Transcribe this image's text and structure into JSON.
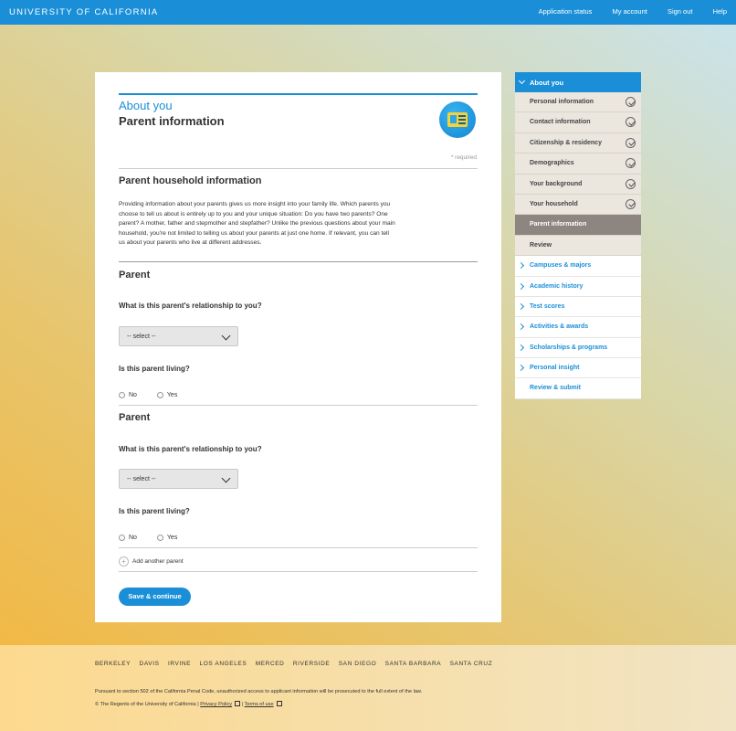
{
  "header": {
    "brand": "UNIVERSITY OF CALIFORNIA",
    "nav": [
      "Application status",
      "My account",
      "Sign out",
      "Help"
    ]
  },
  "page": {
    "section": "About you",
    "title": "Parent information",
    "required_note": "* required",
    "household_heading": "Parent household information",
    "intro": "Providing information about your parents gives us more insight into your family life. Which parents you choose to tell us about is entirely up to you and your unique situation: Do you have two parents? One parent? A mother, father and stepmother and stepfather? Unlike the previous questions about your main household, you're not limited to telling us about your parents at just one home. If relevant, you can tell us about your parents who live at different addresses.",
    "parents": [
      {
        "heading": "Parent",
        "relationship_question": "What is this parent's relationship to you?",
        "relationship_value": "-- select --",
        "living_question": "Is this parent living?",
        "options": [
          "No",
          "Yes"
        ]
      },
      {
        "heading": "Parent",
        "relationship_question": "What is this parent's relationship to you?",
        "relationship_value": "-- select --",
        "living_question": "Is this parent living?",
        "options": [
          "No",
          "Yes"
        ]
      }
    ],
    "add_parent": "Add another parent",
    "save_button": "Save & continue"
  },
  "sidebar": {
    "head": "About you",
    "subitems": [
      {
        "label": "Personal information",
        "complete": true
      },
      {
        "label": "Contact information",
        "complete": true
      },
      {
        "label": "Citizenship & residency",
        "complete": true
      },
      {
        "label": "Demographics",
        "complete": true
      },
      {
        "label": "Your background",
        "complete": true
      },
      {
        "label": "Your household",
        "complete": true
      },
      {
        "label": "Parent information",
        "complete": false,
        "active": true
      },
      {
        "label": "Review",
        "complete": false
      }
    ],
    "items": [
      "Campuses & majors",
      "Academic history",
      "Test scores",
      "Activities & awards",
      "Scholarships & programs",
      "Personal insight",
      "Review & submit"
    ]
  },
  "footer": {
    "campuses": [
      "BERKELEY",
      "DAVIS",
      "IRVINE",
      "LOS ANGELES",
      "MERCED",
      "RIVERSIDE",
      "SAN DIEGO",
      "SANTA BARBARA",
      "SANTA CRUZ"
    ],
    "legal": "Pursuant to section 502 of the California Penal Code, unauthorized access to applicant information will be prosecuted to the full extent of the law.",
    "copyright": "© The Regents of the University of California |",
    "privacy": "Privacy Policy",
    "sep": "|",
    "terms": "Terms of use"
  },
  "colors": {
    "brand_blue": "#1a8fd8",
    "active_gray": "#8d8680",
    "sub_bg": "#ebe6de"
  },
  "icons": {
    "badge": "id-card-icon",
    "complete": "check-circle-icon",
    "external": "external-link-icon"
  }
}
